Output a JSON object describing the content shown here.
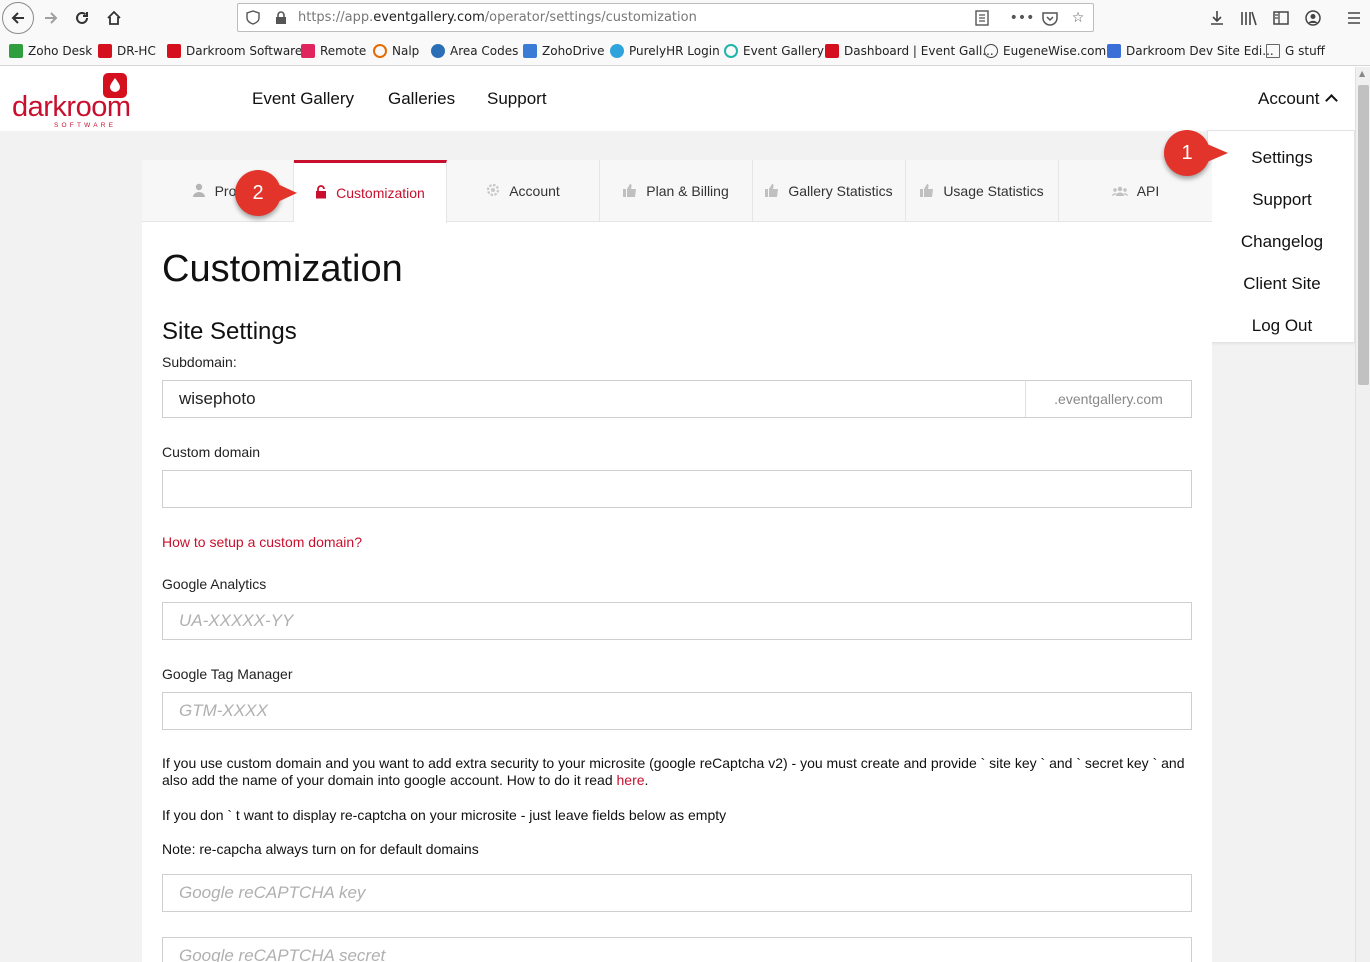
{
  "browser": {
    "url_prefix": "https://app.",
    "url_domain": "eventgallery.com",
    "url_path": "/operator/settings/customization"
  },
  "bookmarks": [
    {
      "label": "Zoho Desk",
      "color": "#2e9e3e"
    },
    {
      "label": "DR-HC",
      "color": "#d4101f"
    },
    {
      "label": "Darkroom Software",
      "color": "#d4101f"
    },
    {
      "label": "Remote",
      "color": "#e0245e"
    },
    {
      "label": "Nalp",
      "color": "#e66a00"
    },
    {
      "label": "Area Codes",
      "color": "#2a6fb5"
    },
    {
      "label": "ZohoDrive",
      "color": "#3a7bd5"
    },
    {
      "label": "PurelyHR Login",
      "color": "#2ea3dc"
    },
    {
      "label": "Event Gallery",
      "color": "#1fb5a8"
    },
    {
      "label": "Dashboard | Event Gall...",
      "color": "#d4101f"
    },
    {
      "label": "EugeneWise.com",
      "color": "#444444"
    },
    {
      "label": "Darkroom Dev Site Edi...",
      "color": "#3a6fd8"
    },
    {
      "label": "G stuff",
      "color": "#777777"
    }
  ],
  "site": {
    "logo_text": "darkroom",
    "logo_sub": "SOFTWARE",
    "nav": [
      "Event Gallery",
      "Galleries",
      "Support"
    ],
    "account_label": "Account",
    "account_menu": [
      "Settings",
      "Support",
      "Changelog",
      "Client Site",
      "Log Out"
    ]
  },
  "tabs": [
    {
      "label": "Profi",
      "icon": "user-icon"
    },
    {
      "label": "Customization",
      "icon": "lock-open-icon",
      "active": true
    },
    {
      "label": "Account",
      "icon": "gear-icon"
    },
    {
      "label": "Plan & Billing",
      "icon": "thumbs-up-icon"
    },
    {
      "label": "Gallery Statistics",
      "icon": "thumbs-up-icon"
    },
    {
      "label": "Usage Statistics",
      "icon": "thumbs-up-icon"
    },
    {
      "label": "API",
      "icon": "users-icon"
    }
  ],
  "content": {
    "title": "Customization",
    "section_title": "Site Settings",
    "subdomain_label": "Subdomain:",
    "subdomain_value": "wisephoto",
    "subdomain_suffix": ".eventgallery.com",
    "custom_domain_label": "Custom domain",
    "custom_domain_value": "",
    "custom_domain_help": "How to setup a custom domain?",
    "ga_label": "Google Analytics",
    "ga_placeholder": "UA-XXXXX-YY",
    "gtm_label": "Google Tag Manager",
    "gtm_placeholder": "GTM-XXXX",
    "recaptcha_info_text": "If you use custom domain and you want to add extra security to your microsite (google reCaptcha v2) - you must create and provide  ` site key `  and  ` secret key `  and also add the name of your domain into google account. How to do it read ",
    "recaptcha_info_link": "here",
    "recaptcha_info_end": ".",
    "recaptcha_skip_text": "If you don ` t want to display re-captcha on your microsite - just leave fields below as empty",
    "recaptcha_note": "Note: re-capcha always turn on for default domains",
    "recaptcha_key_placeholder": "Google reCAPTCHA key",
    "recaptcha_secret_placeholder": "Google reCAPTCHA secret"
  },
  "callouts": [
    "1",
    "2"
  ],
  "colors": {
    "accent": "#c8102e",
    "badge": "#e2342a"
  }
}
